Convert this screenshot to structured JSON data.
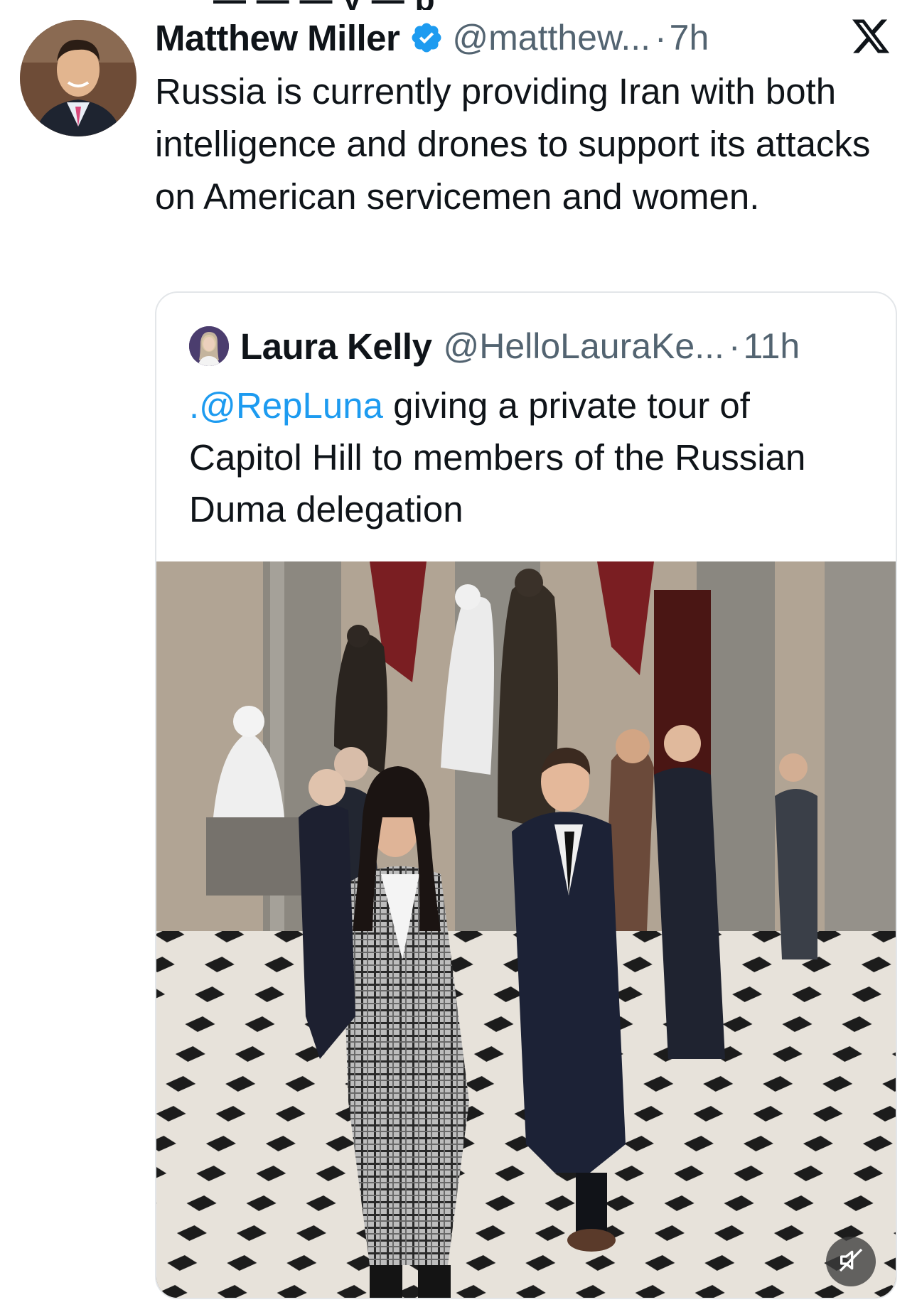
{
  "tweet": {
    "author_name": "Matthew Miller",
    "handle": "@matthew...",
    "separator": "·",
    "time": "7h",
    "text": "Russia is currently providing Iran with both intelligence and drones to support its attacks on American servicemen and women."
  },
  "icons": {
    "verified": "verified-badge-icon",
    "platform": "x-logo-icon",
    "mute": "volume-muted-icon"
  },
  "quoted_tweet": {
    "author_name": "Laura Kelly",
    "handle": "@HelloLauraKe...",
    "separator": "·",
    "time": "11h",
    "mention": ".@RepLuna",
    "text": " giving a private tour of Capitol Hill to members of the Russian Duma delegation"
  },
  "colors": {
    "verified_blue": "#1d9bf0",
    "link_blue": "#1d9bf0",
    "secondary_text": "#536471",
    "primary_text": "#0f1419"
  }
}
